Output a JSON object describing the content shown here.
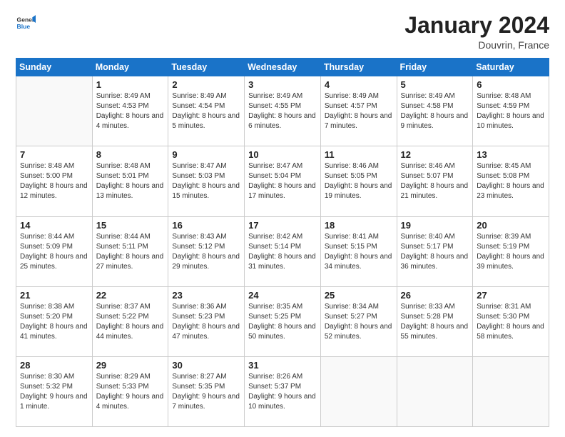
{
  "header": {
    "logo": {
      "general": "General",
      "blue": "Blue"
    },
    "title": "January 2024",
    "location": "Douvrin, France"
  },
  "weekdays": [
    "Sunday",
    "Monday",
    "Tuesday",
    "Wednesday",
    "Thursday",
    "Friday",
    "Saturday"
  ],
  "weeks": [
    [
      {
        "day": "",
        "sunrise": "",
        "sunset": "",
        "daylight": ""
      },
      {
        "day": "1",
        "sunrise": "Sunrise: 8:49 AM",
        "sunset": "Sunset: 4:53 PM",
        "daylight": "Daylight: 8 hours and 4 minutes."
      },
      {
        "day": "2",
        "sunrise": "Sunrise: 8:49 AM",
        "sunset": "Sunset: 4:54 PM",
        "daylight": "Daylight: 8 hours and 5 minutes."
      },
      {
        "day": "3",
        "sunrise": "Sunrise: 8:49 AM",
        "sunset": "Sunset: 4:55 PM",
        "daylight": "Daylight: 8 hours and 6 minutes."
      },
      {
        "day": "4",
        "sunrise": "Sunrise: 8:49 AM",
        "sunset": "Sunset: 4:57 PM",
        "daylight": "Daylight: 8 hours and 7 minutes."
      },
      {
        "day": "5",
        "sunrise": "Sunrise: 8:49 AM",
        "sunset": "Sunset: 4:58 PM",
        "daylight": "Daylight: 8 hours and 9 minutes."
      },
      {
        "day": "6",
        "sunrise": "Sunrise: 8:48 AM",
        "sunset": "Sunset: 4:59 PM",
        "daylight": "Daylight: 8 hours and 10 minutes."
      }
    ],
    [
      {
        "day": "7",
        "sunrise": "Sunrise: 8:48 AM",
        "sunset": "Sunset: 5:00 PM",
        "daylight": "Daylight: 8 hours and 12 minutes."
      },
      {
        "day": "8",
        "sunrise": "Sunrise: 8:48 AM",
        "sunset": "Sunset: 5:01 PM",
        "daylight": "Daylight: 8 hours and 13 minutes."
      },
      {
        "day": "9",
        "sunrise": "Sunrise: 8:47 AM",
        "sunset": "Sunset: 5:03 PM",
        "daylight": "Daylight: 8 hours and 15 minutes."
      },
      {
        "day": "10",
        "sunrise": "Sunrise: 8:47 AM",
        "sunset": "Sunset: 5:04 PM",
        "daylight": "Daylight: 8 hours and 17 minutes."
      },
      {
        "day": "11",
        "sunrise": "Sunrise: 8:46 AM",
        "sunset": "Sunset: 5:05 PM",
        "daylight": "Daylight: 8 hours and 19 minutes."
      },
      {
        "day": "12",
        "sunrise": "Sunrise: 8:46 AM",
        "sunset": "Sunset: 5:07 PM",
        "daylight": "Daylight: 8 hours and 21 minutes."
      },
      {
        "day": "13",
        "sunrise": "Sunrise: 8:45 AM",
        "sunset": "Sunset: 5:08 PM",
        "daylight": "Daylight: 8 hours and 23 minutes."
      }
    ],
    [
      {
        "day": "14",
        "sunrise": "Sunrise: 8:44 AM",
        "sunset": "Sunset: 5:09 PM",
        "daylight": "Daylight: 8 hours and 25 minutes."
      },
      {
        "day": "15",
        "sunrise": "Sunrise: 8:44 AM",
        "sunset": "Sunset: 5:11 PM",
        "daylight": "Daylight: 8 hours and 27 minutes."
      },
      {
        "day": "16",
        "sunrise": "Sunrise: 8:43 AM",
        "sunset": "Sunset: 5:12 PM",
        "daylight": "Daylight: 8 hours and 29 minutes."
      },
      {
        "day": "17",
        "sunrise": "Sunrise: 8:42 AM",
        "sunset": "Sunset: 5:14 PM",
        "daylight": "Daylight: 8 hours and 31 minutes."
      },
      {
        "day": "18",
        "sunrise": "Sunrise: 8:41 AM",
        "sunset": "Sunset: 5:15 PM",
        "daylight": "Daylight: 8 hours and 34 minutes."
      },
      {
        "day": "19",
        "sunrise": "Sunrise: 8:40 AM",
        "sunset": "Sunset: 5:17 PM",
        "daylight": "Daylight: 8 hours and 36 minutes."
      },
      {
        "day": "20",
        "sunrise": "Sunrise: 8:39 AM",
        "sunset": "Sunset: 5:19 PM",
        "daylight": "Daylight: 8 hours and 39 minutes."
      }
    ],
    [
      {
        "day": "21",
        "sunrise": "Sunrise: 8:38 AM",
        "sunset": "Sunset: 5:20 PM",
        "daylight": "Daylight: 8 hours and 41 minutes."
      },
      {
        "day": "22",
        "sunrise": "Sunrise: 8:37 AM",
        "sunset": "Sunset: 5:22 PM",
        "daylight": "Daylight: 8 hours and 44 minutes."
      },
      {
        "day": "23",
        "sunrise": "Sunrise: 8:36 AM",
        "sunset": "Sunset: 5:23 PM",
        "daylight": "Daylight: 8 hours and 47 minutes."
      },
      {
        "day": "24",
        "sunrise": "Sunrise: 8:35 AM",
        "sunset": "Sunset: 5:25 PM",
        "daylight": "Daylight: 8 hours and 50 minutes."
      },
      {
        "day": "25",
        "sunrise": "Sunrise: 8:34 AM",
        "sunset": "Sunset: 5:27 PM",
        "daylight": "Daylight: 8 hours and 52 minutes."
      },
      {
        "day": "26",
        "sunrise": "Sunrise: 8:33 AM",
        "sunset": "Sunset: 5:28 PM",
        "daylight": "Daylight: 8 hours and 55 minutes."
      },
      {
        "day": "27",
        "sunrise": "Sunrise: 8:31 AM",
        "sunset": "Sunset: 5:30 PM",
        "daylight": "Daylight: 8 hours and 58 minutes."
      }
    ],
    [
      {
        "day": "28",
        "sunrise": "Sunrise: 8:30 AM",
        "sunset": "Sunset: 5:32 PM",
        "daylight": "Daylight: 9 hours and 1 minute."
      },
      {
        "day": "29",
        "sunrise": "Sunrise: 8:29 AM",
        "sunset": "Sunset: 5:33 PM",
        "daylight": "Daylight: 9 hours and 4 minutes."
      },
      {
        "day": "30",
        "sunrise": "Sunrise: 8:27 AM",
        "sunset": "Sunset: 5:35 PM",
        "daylight": "Daylight: 9 hours and 7 minutes."
      },
      {
        "day": "31",
        "sunrise": "Sunrise: 8:26 AM",
        "sunset": "Sunset: 5:37 PM",
        "daylight": "Daylight: 9 hours and 10 minutes."
      },
      {
        "day": "",
        "sunrise": "",
        "sunset": "",
        "daylight": ""
      },
      {
        "day": "",
        "sunrise": "",
        "sunset": "",
        "daylight": ""
      },
      {
        "day": "",
        "sunrise": "",
        "sunset": "",
        "daylight": ""
      }
    ]
  ]
}
